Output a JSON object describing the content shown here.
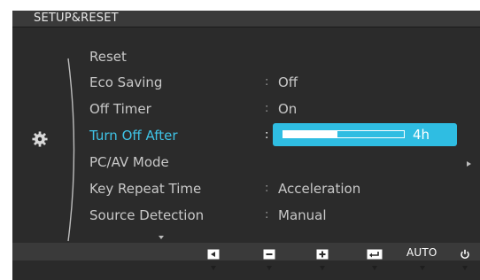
{
  "header": {
    "title": "SETUP&RESET"
  },
  "menu": {
    "items": [
      {
        "label": "Reset",
        "value": ""
      },
      {
        "label": "Eco Saving",
        "value": "Off"
      },
      {
        "label": "Off Timer",
        "value": "On"
      },
      {
        "label": "Turn Off After",
        "value": "4h",
        "selected": true
      },
      {
        "label": "PC/AV Mode",
        "value": "",
        "has_submenu": true
      },
      {
        "label": "Key Repeat Time",
        "value": "Acceleration"
      },
      {
        "label": "Source Detection",
        "value": "Manual"
      }
    ]
  },
  "slider": {
    "fraction": 0.45,
    "display": "4h"
  },
  "separators": [
    ":",
    ":",
    ":",
    ":",
    ":"
  ],
  "footer": {
    "keys": [
      {
        "name": "left-key",
        "icon": "left-arrow-icon"
      },
      {
        "name": "minus-key",
        "icon": "minus-icon"
      },
      {
        "name": "plus-key",
        "icon": "plus-icon"
      },
      {
        "name": "enter-key",
        "icon": "enter-icon"
      },
      {
        "name": "auto-key",
        "label": "AUTO"
      },
      {
        "name": "power-key",
        "icon": "power-icon"
      }
    ]
  },
  "colors": {
    "accent": "#2fbde2",
    "selected_text": "#3fc3e6",
    "background": "#2b2b2b"
  }
}
